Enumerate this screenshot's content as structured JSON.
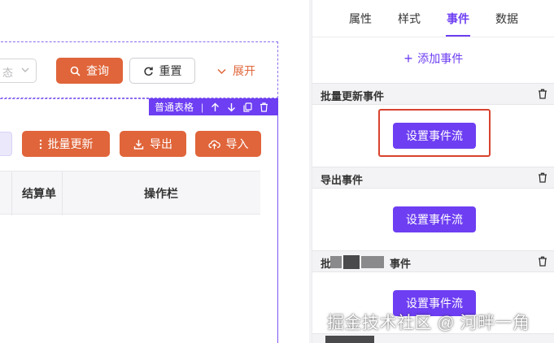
{
  "filter_form": {
    "status_select_partial": "态",
    "query_button": "查询",
    "reset_button": "重置",
    "expand_link": "展开"
  },
  "table_component": {
    "toolbar_label": "普通表格",
    "toolbar_separator": "|",
    "buttons": {
      "batch_update": "批量更新",
      "export": "导出",
      "import": "导入"
    },
    "columns": [
      "结算单",
      "操作栏"
    ]
  },
  "panel": {
    "tabs": [
      "属性",
      "样式",
      "事件",
      "数据"
    ],
    "active_tab": "事件",
    "add_event": "添加事件",
    "sections": [
      {
        "title": "批量更新事件",
        "button": "设置事件流"
      },
      {
        "title": "导出事件",
        "button": "设置事件流"
      },
      {
        "title_prefix": "批",
        "title_suffix": "事件",
        "button": "设置事件流"
      }
    ]
  },
  "watermark": "掘金技术社区 @ 河畔一角",
  "colors": {
    "accent_orange": "#e0653a",
    "accent_purple": "#6d3ef2",
    "highlight_red": "#d9432f"
  }
}
